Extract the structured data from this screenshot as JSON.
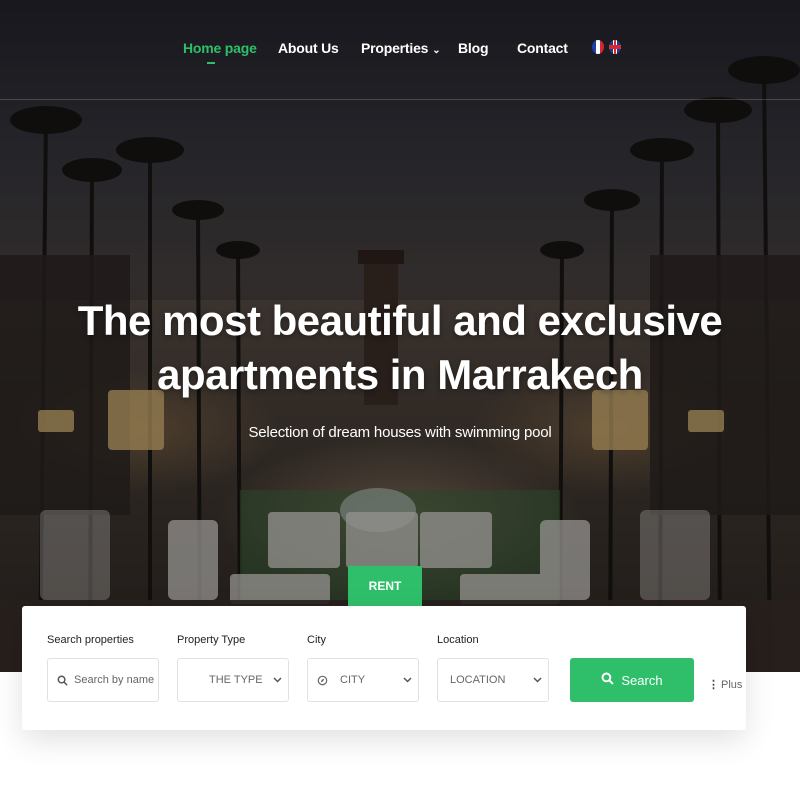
{
  "nav": {
    "items": [
      {
        "label": "Home page",
        "active": true
      },
      {
        "label": "About Us",
        "active": false
      },
      {
        "label": "Properties",
        "active": false,
        "has_dropdown": true
      },
      {
        "label": "Blog",
        "active": false
      },
      {
        "label": "Contact",
        "active": false
      }
    ],
    "languages": [
      "fr-flag-icon",
      "uk-flag-icon"
    ]
  },
  "hero": {
    "title_line1": "The most beautiful and exclusive",
    "title_line2": "apartments in Marrakech",
    "subtitle": "Selection of dream houses with swimming pool"
  },
  "search": {
    "active_tab": "RENT",
    "fields": {
      "keyword": {
        "label": "Search properties",
        "placeholder": "Search by name ..",
        "icon": "search-icon"
      },
      "type": {
        "label": "Property Type",
        "value": "THE TYPE",
        "icon": "chevron-down-icon"
      },
      "city": {
        "label": "City",
        "value": "CITY",
        "icon": "compass-icon"
      },
      "location": {
        "label": "Location",
        "value": "LOCATION",
        "icon": "chevron-down-icon"
      }
    },
    "button_label": "Search",
    "more_label": "Plus"
  },
  "colors": {
    "accent": "#2fbf6a",
    "nav_text": "#ffffff",
    "panel_bg": "#ffffff"
  }
}
